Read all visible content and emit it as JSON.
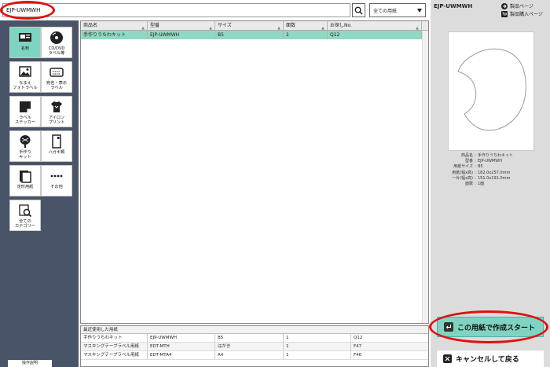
{
  "search": {
    "value": "EJP-UWMWH",
    "placeholder": ""
  },
  "filter": {
    "selected": "全ての用紙"
  },
  "sidebar": {
    "categories": [
      {
        "key": "meishi",
        "label": "名刺",
        "icon": "business-card-icon",
        "active": true
      },
      {
        "key": "cddvd",
        "label": "CD/DVD\nラベル等",
        "icon": "disc-icon",
        "active": false
      },
      {
        "key": "namae",
        "label": "なまえ\nフォトラベル",
        "icon": "name-photo-label-icon",
        "active": false
      },
      {
        "key": "atena",
        "label": "宛名・表示\nラベル",
        "icon": "address-label-icon",
        "active": false
      },
      {
        "key": "sticker",
        "label": "ラベル\nステッカー",
        "icon": "sticker-icon",
        "active": false
      },
      {
        "key": "iron",
        "label": "アイロン\nプリント",
        "icon": "tshirt-icon",
        "active": false
      },
      {
        "key": "tezukuri",
        "label": "手作り\nキット",
        "icon": "fan-icon",
        "active": false
      },
      {
        "key": "hagaki",
        "label": "ハガキ類",
        "icon": "postcard-icon",
        "active": false
      },
      {
        "key": "teikei",
        "label": "定形用紙",
        "icon": "paper-stack-icon",
        "active": false
      },
      {
        "key": "sonota",
        "label": "その他",
        "icon": "more-dots-icon",
        "active": false
      },
      {
        "key": "all",
        "label": "全ての\nカテゴリー",
        "icon": "search-category-icon",
        "active": false
      }
    ],
    "bottom_label": "操作説明"
  },
  "table": {
    "columns": [
      "商品名",
      "型番",
      "サイズ",
      "面数",
      "お探しNo."
    ],
    "rows": [
      [
        "手作りうちわキット",
        "EJP-UWMWH",
        "B5",
        "1",
        "Q12"
      ]
    ]
  },
  "recent": {
    "title": "最近使用した用紙",
    "rows": [
      [
        "手作りうちわキット",
        "EJP-UWMWH",
        "B5",
        "1",
        "Q12"
      ],
      [
        "マスキングテープラベル用紙",
        "EDT-MTH",
        "はがき",
        "1",
        "F47"
      ],
      [
        "マスキングテープラベル用紙",
        "EDT-MTA4",
        "A4",
        "1",
        "F46"
      ]
    ]
  },
  "detail": {
    "sku": "EJP-UWMWH",
    "link_product": "製品ページ",
    "link_purchase": "製品購入ページ",
    "fields": [
      {
        "k": "商品名",
        "v": "手作りうちわキット"
      },
      {
        "k": "型番",
        "v": "EJP-UWMWH"
      },
      {
        "k": "用紙サイズ",
        "v": "B5"
      },
      {
        "k": "用紙(幅x高)",
        "v": "182.0x257.0mm"
      },
      {
        "k": "一片(幅x高)",
        "v": "151.0x191.0mm"
      },
      {
        "k": "面数",
        "v": "1面"
      }
    ]
  },
  "actions": {
    "start": "この用紙で作成スタート",
    "cancel": "キャンセルして戻る"
  },
  "colors": {
    "accent": "#7ed4c0",
    "selected_row": "#8fd8c4",
    "sidebar": "#4a5468",
    "highlight": "#e01010"
  }
}
